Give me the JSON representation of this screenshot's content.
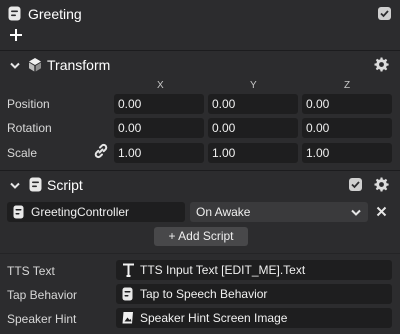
{
  "object": {
    "name": "Greeting"
  },
  "transform": {
    "title": "Transform",
    "axes": [
      "X",
      "Y",
      "Z"
    ],
    "rows": [
      {
        "label": "Position",
        "values": [
          "0.00",
          "0.00",
          "0.00"
        ]
      },
      {
        "label": "Rotation",
        "values": [
          "0.00",
          "0.00",
          "0.00"
        ]
      },
      {
        "label": "Scale",
        "values": [
          "1.00",
          "1.00",
          "1.00"
        ]
      }
    ]
  },
  "script": {
    "title": "Script",
    "script_name": "GreetingController",
    "event": "On Awake",
    "add_button": "+ Add Script",
    "inputs": [
      {
        "label": "TTS Text",
        "value": "TTS Input Text [EDIT_ME].Text",
        "icon": "text-icon"
      },
      {
        "label": "Tap Behavior",
        "value": "Tap to Speech Behavior",
        "icon": "script-icon"
      },
      {
        "label": "Speaker Hint",
        "value": "Speaker Hint Screen Image",
        "icon": "image-icon"
      }
    ]
  },
  "colors": {
    "background": "#2c2c2e",
    "field": "#1e1e1f",
    "divider": "#1c1c1e",
    "checkbox": "#cfcfcf"
  }
}
